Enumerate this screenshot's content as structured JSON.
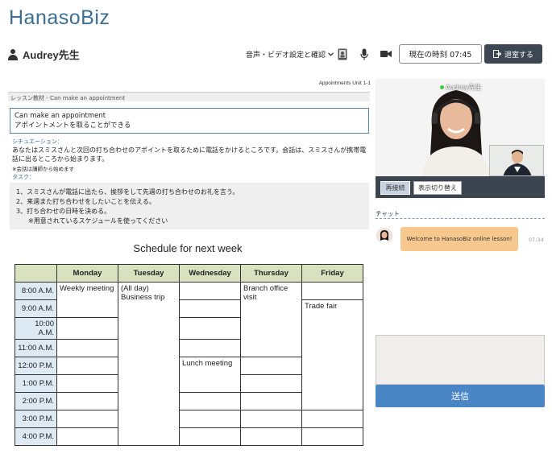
{
  "app": {
    "logo": "HanasoBiz"
  },
  "header": {
    "teacher_name": "Audrey先生",
    "av_settings_label": "音声・ビデオ設定と確認",
    "current_time_label": "現在の時刻 07:45",
    "exit_label": "退室する"
  },
  "material": {
    "unit_label": "Appointments Unit 1-1",
    "breadcrumb": "レッスン教材 - Can make an appointment",
    "title_en": "Can make an appointment",
    "title_ja": "アポイントメントを取ることができる",
    "situation_label": "シチュエーション：",
    "situation_text": "あなたはスミスさんと次回の打ち合わせのアポイントを取るために電話をかけるところです。会話は、スミスさんが携帯電話に出るところから始まります。",
    "note": "※会話は講師から始めます",
    "task_label": "タスク：",
    "tasks": [
      "1、スミスさんが電話に出たら、挨拶をして先週の打ち合わせのお礼を言う。",
      "2、来週また打ち合わせをしたいことを伝える。",
      "3、打ち合わせの日時を決める。"
    ],
    "task_sub": "※用意されているスケジュールを使ってください"
  },
  "schedule": {
    "title": "Schedule for next week",
    "days": [
      "Monday",
      "Tuesday",
      "Wednesday",
      "Thursday",
      "Friday"
    ],
    "times": [
      "8:00 A.M.",
      "9:00 A.M.",
      "10:00 A.M.",
      "11:00 A.M.",
      "12:00 P.M.",
      "1:00 P.M.",
      "2:00 P.M.",
      "3:00 P.M.",
      "4:00 P.M."
    ],
    "events": {
      "monday_weekly": "Weekly meeting",
      "tuesday_allday": "(All day)",
      "tuesday_trip": "Business trip",
      "wednesday_lunch": "Lunch meeting",
      "thursday_branch": "Branch office visit",
      "friday_fair": "Trade fair"
    }
  },
  "video": {
    "label": "Audrey先生",
    "reconnect_label": "再接続",
    "switch_label": "表示切り替え"
  },
  "chat": {
    "title": "チャット",
    "messages": [
      {
        "text": "Welcome to HanasoBiz online lesson!",
        "time": "07:34"
      }
    ],
    "send_label": "送信"
  }
}
